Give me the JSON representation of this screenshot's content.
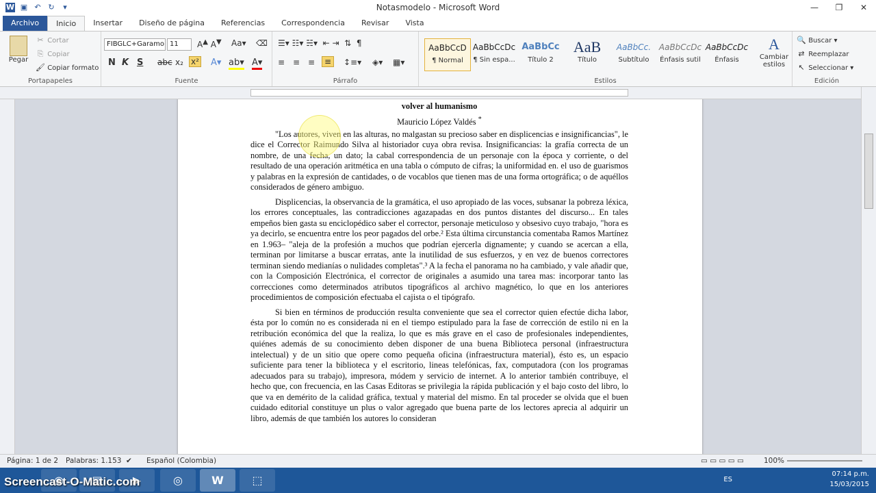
{
  "window": {
    "title": "Notasmodelo - Microsoft Word"
  },
  "qat": {
    "save_icon": "save-icon",
    "undo_icon": "undo-icon",
    "redo_icon": "redo-icon"
  },
  "tabs": [
    "Archivo",
    "Inicio",
    "Insertar",
    "Diseño de página",
    "Referencias",
    "Correspondencia",
    "Revisar",
    "Vista"
  ],
  "ribbon": {
    "clipboard": {
      "paste": "Pegar",
      "cut": "Cortar",
      "copy": "Copiar",
      "format_painter": "Copiar formato",
      "label": "Portapapeles"
    },
    "font": {
      "family": "FIBGLC+Garamo",
      "size": "11",
      "label": "Fuente",
      "bold": "N",
      "italic": "K",
      "underline": "S"
    },
    "paragraph": {
      "label": "Párrafo"
    },
    "styles": {
      "label": "Estilos",
      "items": [
        {
          "preview": "AaBbCcD",
          "name": "¶ Normal"
        },
        {
          "preview": "AaBbCcDc",
          "name": "¶ Sin espa..."
        },
        {
          "preview": "AaBbCc",
          "name": "Título 2"
        },
        {
          "preview": "AaB",
          "name": "Título"
        },
        {
          "preview": "AaBbCc.",
          "name": "Subtítulo"
        },
        {
          "preview": "AaBbCcDc",
          "name": "Énfasis sutil"
        },
        {
          "preview": "AaBbCcDc",
          "name": "Énfasis"
        }
      ],
      "change": "Cambiar estilos"
    },
    "editing": {
      "find": "Buscar",
      "replace": "Reemplazar",
      "select": "Seleccionar",
      "label": "Edición"
    }
  },
  "document": {
    "title": "volver al humanismo",
    "author": "Mauricio López Valdés",
    "author_note": "*",
    "p1": "\"Los autores, viven en las alturas, no malgastan su precioso saber en displicencias e insignificancias\", le dice el Corrector Raimundo Silva al historiador cuya obra revisa. Insignificancias: la grafía correcta de un nombre, de una fecha, un dato; la cabal correspondencia de un personaje con la época y corriente, o del resultado de una operación aritmética en una tabla o cómputo de cifras; la uniformidad en. el uso de guarismos y palabras en la expresión de cantidades, o de vocablos que tienen mas de una forma ortográfica; o de aquéllos considerados de género ambiguo.",
    "p2": "Displicencias, la observancia de la gramática, el uso apropiado de las voces, subsanar la pobreza léxica, los errores conceptuales, las contradicciones agazapadas en dos puntos distantes del discurso... En tales empeños bien gasta su enciclopédico saber el corrector, personaje meticuloso y obsesivo cuyo trabajo, \"hora es ya decirlo, se encuentra entre los peor pagados del orbe.² Esta última circunstancia comentaba Ramos Martínez en 1.963– \"aleja de la profesión a muchos que podrían ejercerla dignamente; y cuando se acercan a ella, terminan por limitarse a buscar erratas, ante la inutilidad de sus esfuerzos, y en vez de buenos correctores terminan siendo medianías o nulidades completas\".³ A la fecha el panorama no ha cambiado, y vale añadir que, con la Composición Electrónica, el corrector de originales a asumido una tarea mas: incorporar tanto las correcciones como determinados atributos tipográficos al archivo magnético, lo que en los anteriores procedimientos de composición efectuaba el cajista o el tipógrafo.",
    "p3": "Si bien en términos de producción resulta conveniente que sea el corrector quien efectúe dicha labor, ésta por lo común no es considerada ni en el tiempo estipulado para la fase de corrección de estilo ni en la retribución económica del que la realiza, lo que es más grave en el caso de profesionales independientes, quiénes además de su conocimiento deben disponer de una buena Biblioteca personal (infraestructura intelectual) y de un sitio que opere como pequeña oficina (infraestructura material), ésto es, un espacio suficiente para tener la biblioteca y el escritorio, lineas telefónicas, fax, computadora (con los programas adecuados para su trabajo), impresora, módem y servicio de internet. A lo anterior también contribuye, el hecho que, con frecuencia, en las Casas Editoras se privilegia la rápida publicación y el bajo costo del libro, lo que va en demérito de la calidad gráfica, textual y material del mismo. En tal proceder se olvida que el buen cuidado editorial constituye un plus o valor agregado que buena parte de los lectores aprecia al adquirir un libro, además de que también los autores lo consideran"
  },
  "status": {
    "page": "Página: 1 de 2",
    "words": "Palabras: 1.153",
    "language": "Español (Colombia)",
    "zoom": "100%"
  },
  "taskbar": {
    "watermark": "Screencast-O-Matic.com",
    "lang": "ES",
    "time": "07:14 p.m.",
    "date": "15/03/2015"
  }
}
